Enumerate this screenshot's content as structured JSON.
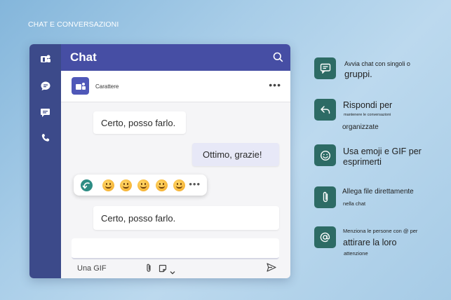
{
  "section_title": "CHAT E CONVERSAZIONI",
  "app": {
    "header_title": "Chat",
    "chat_name": "Carattere",
    "more_label": "•••",
    "messages": [
      {
        "text": "Certo, posso farlo.",
        "mine": false
      },
      {
        "text": "Ottimo, grazie!",
        "mine": true
      },
      {
        "text": "Certo, posso farlo.",
        "mine": false
      }
    ],
    "reactions_more": "•••",
    "compose_gif_label": "Una GIF",
    "rail_icons": [
      "teams-logo-icon",
      "chat-bubble-icon",
      "message-icon",
      "phone-icon"
    ]
  },
  "features": [
    {
      "icon": "chat-icon",
      "lines": [
        "Avvia chat con singoli o",
        "gruppi."
      ]
    },
    {
      "icon": "reply-icon",
      "lines": [
        "Rispondi per",
        "mantenere le conversazioni",
        "organizzate"
      ]
    },
    {
      "icon": "emoji-icon",
      "lines": [
        "Usa emoji e GIF per",
        "esprimerti"
      ]
    },
    {
      "icon": "attach-icon",
      "lines": [
        "Allega file direttamente",
        "nella chat"
      ]
    },
    {
      "icon": "mention-icon",
      "lines": [
        "Menziona le persone con @ per",
        "attirare la loro",
        "attenzione"
      ]
    }
  ],
  "colors": {
    "rail": "#3c4a8a",
    "header": "#464ea4",
    "feature_icon": "#2d6b65",
    "mine_bubble": "#e7e8f7"
  }
}
